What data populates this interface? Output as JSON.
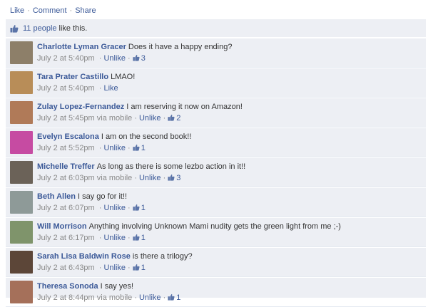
{
  "actions": {
    "like": "Like",
    "comment": "Comment",
    "share": "Share",
    "sep": "·"
  },
  "likes": {
    "link": "11 people",
    "text": "like this."
  },
  "comments": [
    {
      "author": "Charlotte Lyman Gracer",
      "text": "Does it have a happy ending?",
      "time": "July 2 at 5:40pm",
      "via": "",
      "action": "Unlike",
      "likes": "3",
      "avatar_color": "#8d7f69"
    },
    {
      "author": "Tara Prater Castillo",
      "text": "LMAO!",
      "time": "July 2 at 5:40pm",
      "via": "",
      "action": "Like",
      "likes": "",
      "avatar_color": "#b88d58"
    },
    {
      "author": "Zulay Lopez-Fernandez",
      "text": "I am reserving it now on Amazon!",
      "time": "July 2 at 5:45pm",
      "via": "via mobile",
      "action": "Unlike",
      "likes": "2",
      "avatar_color": "#b07a58"
    },
    {
      "author": "Evelyn Escalona",
      "text": "I am on the second book!!",
      "time": "July 2 at 5:52pm",
      "via": "",
      "action": "Unlike",
      "likes": "1",
      "avatar_color": "#c64ba2"
    },
    {
      "author": "Michelle Treffer",
      "text": "As long as there is some lezbo action in it!!",
      "time": "July 2 at 6:03pm",
      "via": "via mobile",
      "action": "Unlike",
      "likes": "3",
      "avatar_color": "#6b6258"
    },
    {
      "author": "Beth Allen",
      "text": "I say go for it!!",
      "time": "July 2 at 6:07pm",
      "via": "",
      "action": "Unlike",
      "likes": "1",
      "avatar_color": "#8e9a98"
    },
    {
      "author": "Will Morrison",
      "text": "Anything involving Unknown Mami nudity gets the green light from me ;-)",
      "time": "July 2 at 6:17pm",
      "via": "",
      "action": "Unlike",
      "likes": "1",
      "avatar_color": "#7f946b"
    },
    {
      "author": "Sarah Lisa Baldwin Rose",
      "text": "is there a trilogy?",
      "time": "July 2 at 6:43pm",
      "via": "",
      "action": "Unlike",
      "likes": "1",
      "avatar_color": "#5c4638"
    },
    {
      "author": "Theresa Sonoda",
      "text": "I say yes!",
      "time": "July 2 at 8:44pm",
      "via": "via mobile",
      "action": "Unlike",
      "likes": "1",
      "avatar_color": "#a5705a"
    }
  ]
}
